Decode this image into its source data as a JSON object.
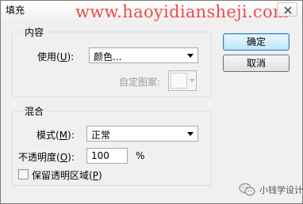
{
  "window": {
    "title": "填充",
    "watermark": "www.haoyidiansheji.com"
  },
  "contents_group": {
    "legend": "内容",
    "use_label": "使用(",
    "use_mnemonic": "U",
    "use_suffix": "):",
    "use_value": "颜色...",
    "custom_pattern_label": "自定图案:"
  },
  "blending_group": {
    "legend": "混合",
    "mode_label": "模式(",
    "mode_mnemonic": "M",
    "mode_suffix": "):",
    "mode_value": "正常",
    "opacity_label": "不透明度(",
    "opacity_mnemonic": "O",
    "opacity_suffix": "):",
    "opacity_value": "100",
    "opacity_unit": "%",
    "preserve_label": "保留透明区域(",
    "preserve_mnemonic": "P",
    "preserve_suffix": ")",
    "preserve_checked": false
  },
  "buttons": {
    "ok": "确定",
    "cancel": "取消"
  },
  "wechat_badge": {
    "text": "小钱学设计"
  },
  "colors": {
    "watermark": "#ef4a4a",
    "default_button_border": "#3c7fb1",
    "group_border": "#d5dfe5"
  }
}
